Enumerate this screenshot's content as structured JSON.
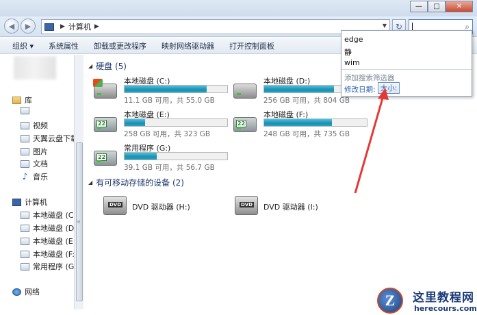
{
  "window": {
    "minimize_glyph": "—",
    "maximize_glyph": "□",
    "close_glyph": "✕"
  },
  "address_bar": {
    "breadcrumb": "计算机",
    "back_glyph": "◀",
    "forward_glyph": "▶",
    "refresh_glyph": "↻",
    "search_value": ""
  },
  "toolbar": {
    "items": [
      "组织 ▾",
      "系统属性",
      "卸载或更改程序",
      "映射网络驱动器",
      "打开控制面板"
    ]
  },
  "sidebar": {
    "library": "库",
    "library_items": [
      "视频",
      "天翼云盘下载",
      "图片",
      "文档",
      "音乐"
    ],
    "computer": "计算机",
    "computer_items": [
      "本地磁盘 (C:)",
      "本地磁盘 (D:)",
      "本地磁盘 (E:)",
      "本地磁盘 (F:)",
      "常用程序 (G:)"
    ],
    "network": "网络"
  },
  "content": {
    "hard_disks_header": "硬盘 (5)",
    "removable_header": "有可移动存储的设备 (2)",
    "drives": [
      {
        "name": "本地磁盘 (C:)",
        "info": "11.1 GB 可用，共 55.0 GB",
        "used_fraction": 0.8
      },
      {
        "name": "本地磁盘 (D:)",
        "info": "256 GB 可用，共 804 GB",
        "used_fraction": 0.68
      },
      {
        "name": "本地磁盘 (E:)",
        "info": "258 GB 可用，共 323 GB",
        "used_fraction": 0.2
      },
      {
        "name": "本地磁盘 (F:)",
        "info": "248 GB 可用，共 735 GB",
        "used_fraction": 0.66
      },
      {
        "name": "常用程序 (G:)",
        "info": "39.1 GB 可用，共 56.7 GB",
        "used_fraction": 0.31
      }
    ],
    "dvd_drives": [
      {
        "name": "DVD 驱动器 (H:)",
        "label": "DVD"
      },
      {
        "name": "DVD 驱动器 (I:)",
        "label": "DVD"
      }
    ]
  },
  "search_dropdown": {
    "suggestions": [
      "edge",
      "静",
      "wim"
    ],
    "add_filter_hint": "添加搜索筛选器",
    "filter_label": "修改日期:",
    "filter_button": "大小:"
  },
  "watermark": {
    "logo_letter": "Z",
    "title": "这里教程网",
    "url": "herecours.com"
  },
  "colors": {
    "drive_bar": "#1a8fb0",
    "annotation_arrow": "#e53935"
  }
}
